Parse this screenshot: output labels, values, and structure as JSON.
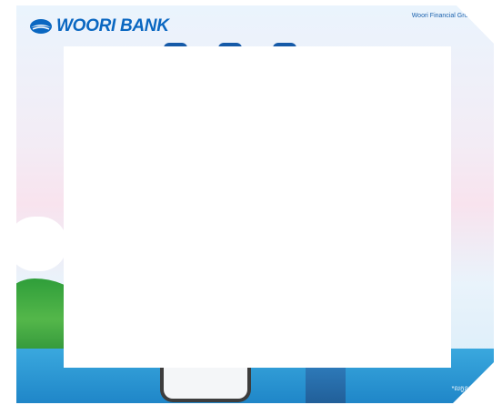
{
  "banner": {
    "logo_text": "WOORI BANK",
    "group_text": "Woori Financial Group, Kor",
    "footnote": "*លក្ខខណ្ឌអនុវត្ត",
    "colors": {
      "brand_blue": "#0a67c1",
      "green": "#2f9e3a",
      "sky": "#eaf4fd",
      "pink": "#f8e3ee",
      "ground_blue": "#1f86c8"
    }
  },
  "modal": {
    "icon": "none"
  }
}
